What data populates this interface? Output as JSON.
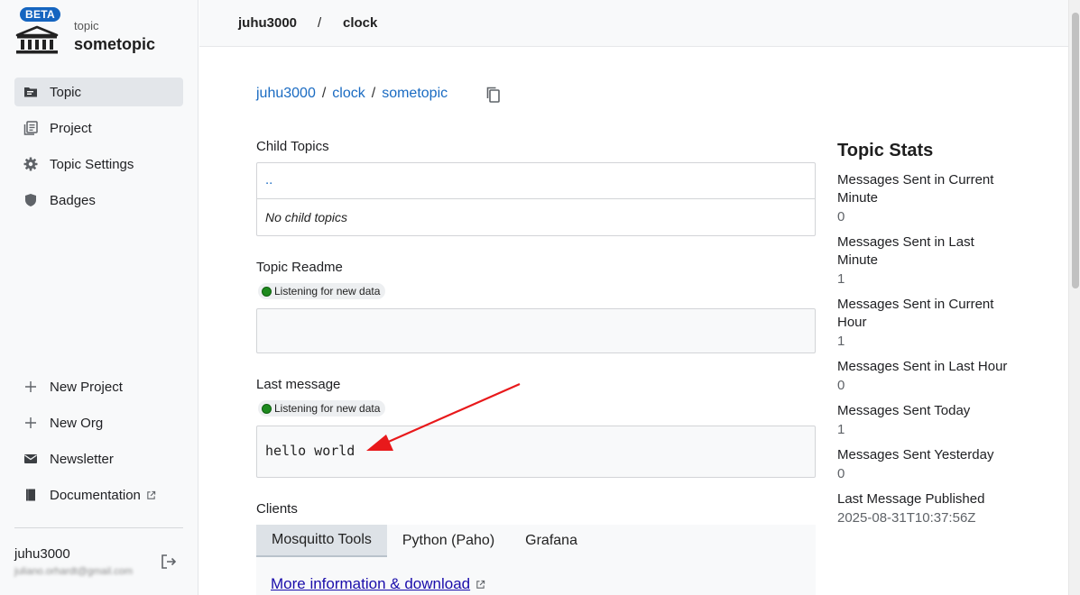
{
  "brand": {
    "beta": "BETA",
    "kicker": "topic",
    "title": "sometopic"
  },
  "sidebar": {
    "items": [
      {
        "label": "Topic",
        "icon": "folder-icon",
        "active": true
      },
      {
        "label": "Project",
        "icon": "collection-icon"
      },
      {
        "label": "Topic Settings",
        "icon": "gear-icon"
      },
      {
        "label": "Badges",
        "icon": "shield-icon"
      }
    ],
    "bottom_items": [
      {
        "label": "New Project",
        "icon": "plus-icon"
      },
      {
        "label": "New Org",
        "icon": "plus-icon"
      },
      {
        "label": "Newsletter",
        "icon": "mail-icon"
      },
      {
        "label": "Documentation",
        "icon": "book-icon",
        "external": true
      }
    ],
    "user": {
      "name": "juhu3000",
      "email": "juliano.orhardt@gmail.com"
    }
  },
  "topbar": {
    "crumbs": [
      "juhu3000",
      "clock"
    ],
    "separator": "/"
  },
  "main": {
    "breadcrumb": [
      "juhu3000",
      "clock",
      "sometopic"
    ],
    "breadcrumb_sep": "/",
    "child_topics": {
      "label": "Child Topics",
      "parent_link": "..",
      "empty_text": "No child topics"
    },
    "readme": {
      "label": "Topic Readme",
      "status": "Listening for new data"
    },
    "last_message": {
      "label": "Last message",
      "status": "Listening for new data",
      "value": "hello world"
    },
    "clients": {
      "label": "Clients",
      "tabs": [
        "Mosquitto Tools",
        "Python (Paho)",
        "Grafana"
      ],
      "active_tab": 0,
      "link": "More information & download"
    }
  },
  "stats": {
    "title": "Topic Stats",
    "items": [
      {
        "label": "Messages Sent in Current Minute",
        "value": "0"
      },
      {
        "label": "Messages Sent in Last Minute",
        "value": "1"
      },
      {
        "label": "Messages Sent in Current Hour",
        "value": "1"
      },
      {
        "label": "Messages Sent in Last Hour",
        "value": "0"
      },
      {
        "label": "Messages Sent Today",
        "value": "1"
      },
      {
        "label": "Messages Sent Yesterday",
        "value": "0"
      },
      {
        "label": "Last Message Published",
        "value": "2025-08-31T10:37:56Z"
      }
    ]
  },
  "colors": {
    "accent": "#1565c0",
    "link": "#1a6bc2",
    "status_green": "#1e8a1e",
    "annotation_red": "#e8191b"
  }
}
